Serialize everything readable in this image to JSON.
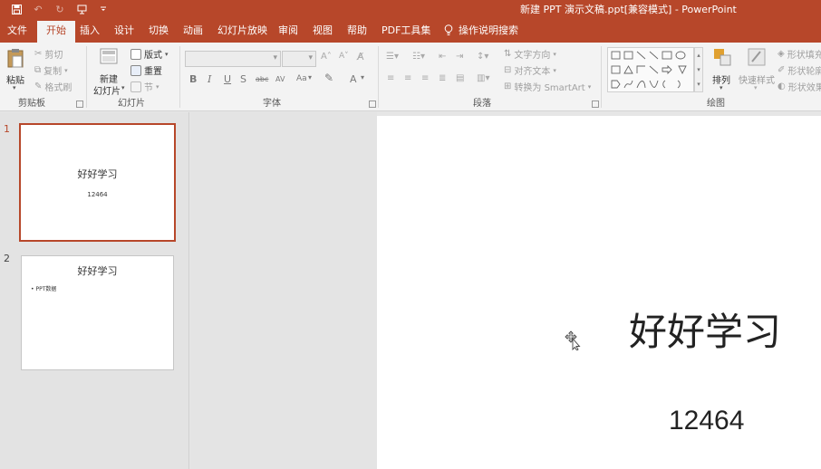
{
  "window": {
    "title": "新建 PPT 演示文稿.ppt[兼容模式]  -  PowerPoint"
  },
  "qat": {
    "save_icon": "save-icon",
    "undo_icon": "undo-icon",
    "redo_icon": "redo-icon",
    "present_icon": "present-icon",
    "customize_icon": "customize-icon"
  },
  "tabs": [
    {
      "label": "文件"
    },
    {
      "label": "开始"
    },
    {
      "label": "插入"
    },
    {
      "label": "设计"
    },
    {
      "label": "切换"
    },
    {
      "label": "动画"
    },
    {
      "label": "幻灯片放映"
    },
    {
      "label": "审阅"
    },
    {
      "label": "视图"
    },
    {
      "label": "帮助"
    },
    {
      "label": "PDF工具集"
    }
  ],
  "tell_me": {
    "label": "操作说明搜索"
  },
  "ribbon": {
    "clipboard": {
      "group": "剪贴板",
      "paste": "粘贴",
      "cut": "剪切",
      "copy": "复制",
      "format_painter": "格式刷"
    },
    "slides": {
      "group": "幻灯片",
      "new_slide_line1": "新建",
      "new_slide_line2": "幻灯片",
      "layout": "版式",
      "reset": "重置",
      "section": "节"
    },
    "font": {
      "group": "字体",
      "bold": "B",
      "italic": "I",
      "underline": "U",
      "shadow": "S",
      "strike": "abc",
      "spacing": "AV",
      "case": "Aa",
      "color": "A"
    },
    "paragraph": {
      "group": "段落",
      "text_direction": "文字方向",
      "align_text": "对齐文本",
      "smartart": "转换为 SmartArt"
    },
    "drawing": {
      "group": "绘图",
      "arrange": "排列",
      "quick_styles": "快速样式",
      "shape_fill": "形状填充",
      "shape_outline": "形状轮廓",
      "shape_effects": "形状效果"
    }
  },
  "slides": [
    {
      "number": "1",
      "title": "好好学习",
      "subtitle": "12464"
    },
    {
      "number": "2",
      "title": "好好学习",
      "bullet": "PPT数据"
    }
  ],
  "current_slide": {
    "title": "好好学习",
    "subtitle": "12464"
  },
  "colors": {
    "accent": "#b7472a",
    "ribbon_bg": "#f3f3f3"
  }
}
